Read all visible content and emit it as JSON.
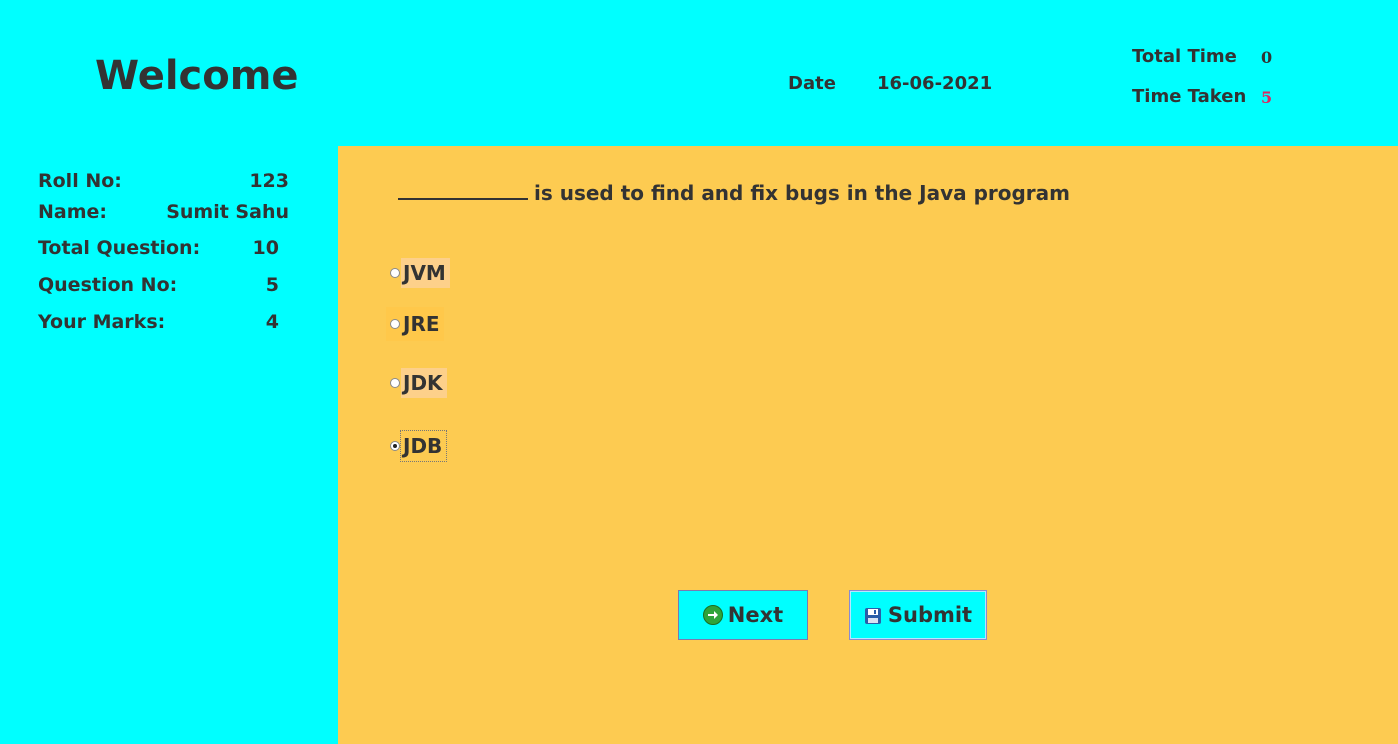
{
  "header": {
    "welcome": "Welcome",
    "date_label": "Date",
    "date_value": "16-06-2021",
    "total_time_label": "Total Time",
    "total_time_value": "0",
    "time_taken_label": "Time Taken",
    "time_taken_value": "5"
  },
  "info": {
    "roll_label": "Roll No:",
    "roll_value": "123",
    "name_label": "Name:",
    "name_value": "Sumit Sahu",
    "total_q_label": "Total Question:",
    "total_q_value": "10",
    "q_no_label": "Question No:",
    "q_no_value": "5",
    "marks_label": "Your Marks:",
    "marks_value": "4"
  },
  "question": {
    "text": "is used to find and fix bugs in the Java program",
    "options": [
      "JVM",
      "JRE",
      "JDK",
      "JDB"
    ],
    "selected": "JDB"
  },
  "buttons": {
    "next": "Next",
    "submit": "Submit"
  },
  "colors": {
    "background": "#00FFFF",
    "panel": "#FDCB51",
    "text": "#333333",
    "time_taken": "#E0245E"
  }
}
